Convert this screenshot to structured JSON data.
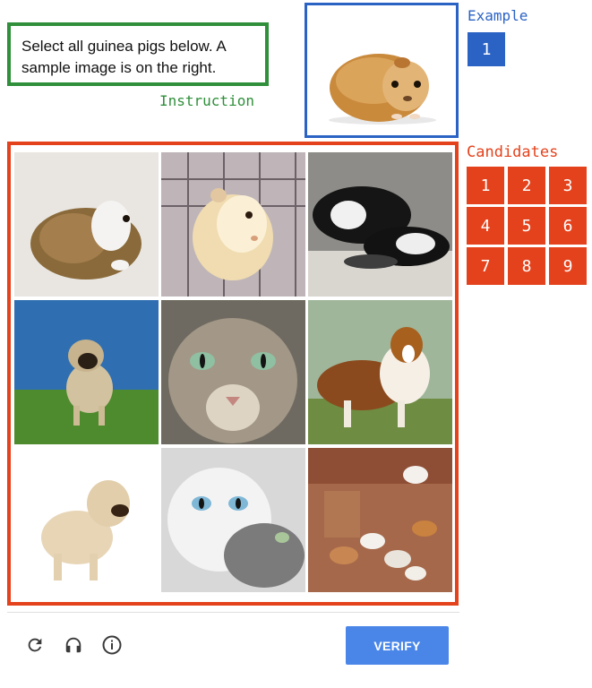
{
  "instruction": {
    "text": "Select all guinea pigs below. A sample image is on the right.",
    "label": "Instruction",
    "color": "#2f8f3a"
  },
  "example": {
    "label": "Example",
    "number": "1",
    "image_subject": "guinea pig",
    "color": "#2b63c4"
  },
  "candidates": {
    "label": "Candidates",
    "color": "#e4421c",
    "numbers": [
      "1",
      "2",
      "3",
      "4",
      "5",
      "6",
      "7",
      "8",
      "9"
    ],
    "tiles": [
      {
        "subject": "guinea pig (white and brown)"
      },
      {
        "subject": "guinea pig (cream) in cage"
      },
      {
        "subject": "black and white cats"
      },
      {
        "subject": "pug running on grass"
      },
      {
        "subject": "tabby cat close-up"
      },
      {
        "subject": "collie dog on grass"
      },
      {
        "subject": "fluffy terrier dog"
      },
      {
        "subject": "white kitten and tabby kitten"
      },
      {
        "subject": "group of guinea pigs"
      }
    ]
  },
  "footer": {
    "reload_icon": "reload-icon",
    "audio_icon": "headphones-icon",
    "info_icon": "info-icon",
    "verify_label": "VERIFY",
    "accent": "#4a86e8"
  }
}
